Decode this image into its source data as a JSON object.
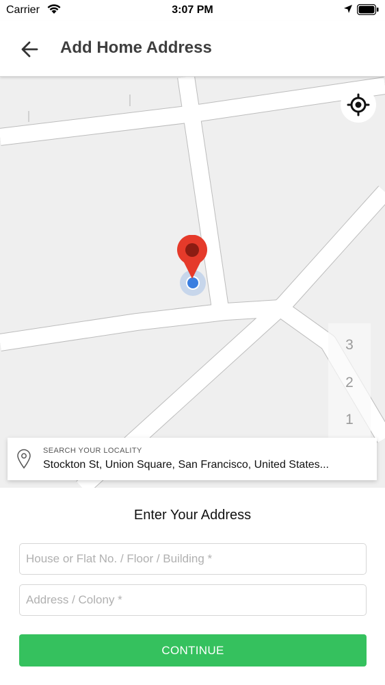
{
  "status_bar": {
    "carrier": "Carrier",
    "time": "3:07 PM"
  },
  "header": {
    "title": "Add Home Address",
    "back_icon": "arrow-left-icon"
  },
  "map": {
    "locate_icon": "crosshair-icon",
    "pin_icon": "map-pin-icon",
    "floor_levels": [
      "3",
      "2",
      "1"
    ]
  },
  "locality": {
    "label": "SEARCH YOUR LOCALITY",
    "value": "Stockton St, Union Square, San Francisco, United States...",
    "icon": "location-outline-icon"
  },
  "form": {
    "title": "Enter Your Address",
    "house_placeholder": "House or Flat No. / Floor / Building *",
    "address_placeholder": "Address / Colony *",
    "continue_label": "CONTINUE"
  },
  "colors": {
    "accent": "#35c15e",
    "pin": "#e53a2a",
    "user_dot": "#3a7ee0"
  }
}
